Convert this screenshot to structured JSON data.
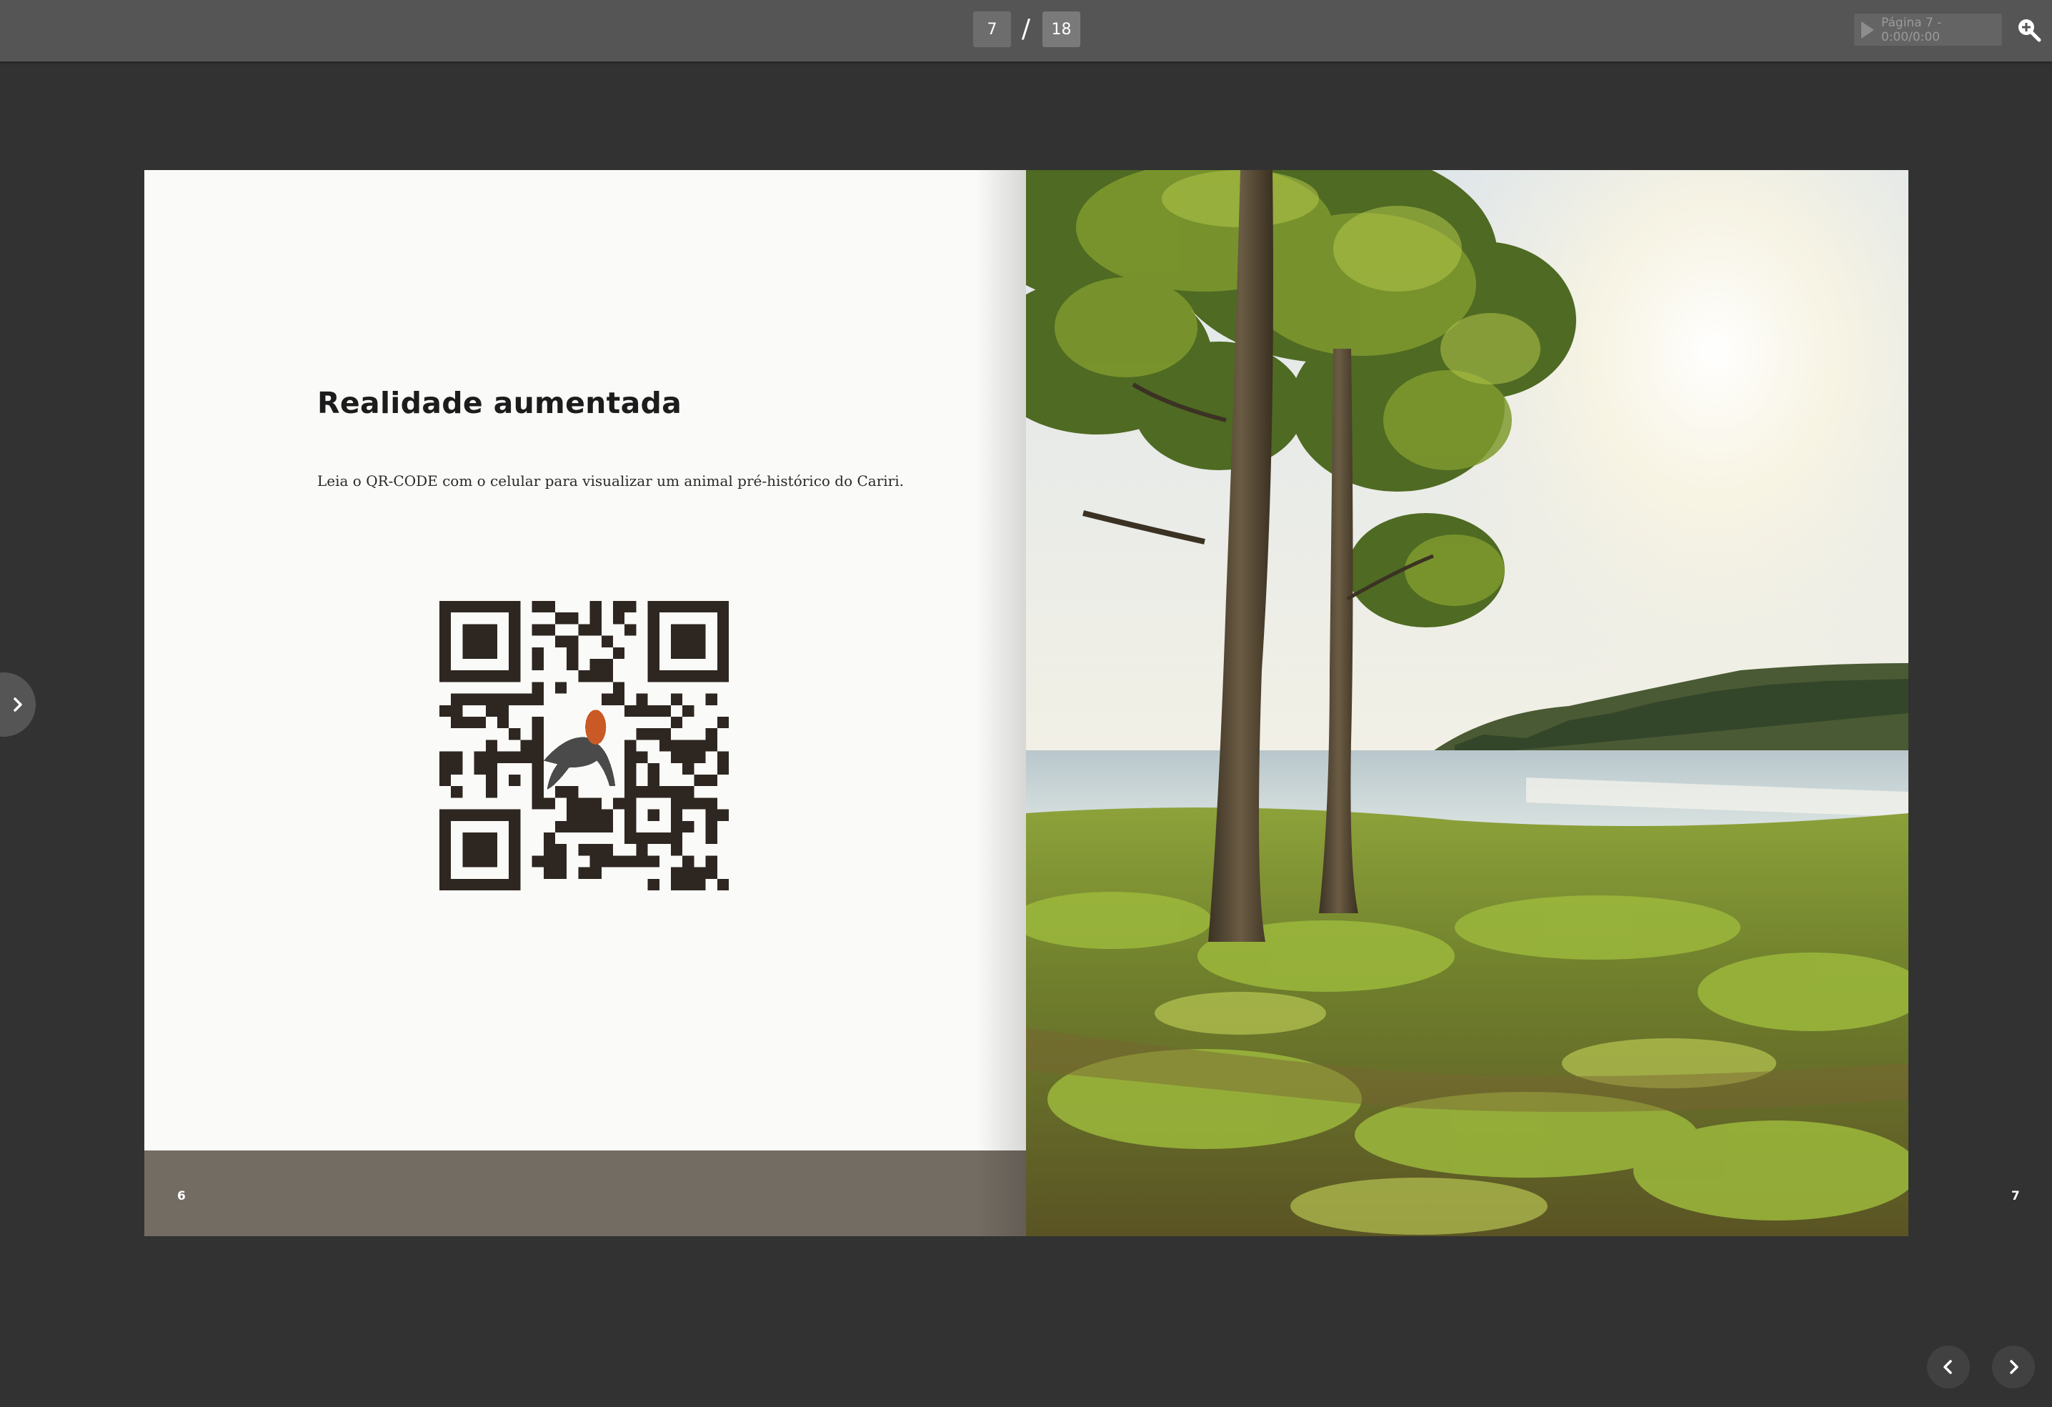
{
  "toolbar": {
    "current_page": "7",
    "separator": "/",
    "total_pages": "18",
    "audio_label": "Página 7 - 0:00/0:00",
    "zoom_icon": "zoom-in-icon"
  },
  "left_page": {
    "heading": "Realidade aumentada",
    "body": "Leia o QR-CODE com o celular para visualizar um animal pré-histórico do Cariri.",
    "page_number": "6",
    "footer_color": "#736c63"
  },
  "right_page": {
    "page_number": "7"
  },
  "controls": {
    "sidebar_icon": "chevron-right-icon",
    "prev_icon": "chevron-left-icon",
    "next_icon": "chevron-right-icon"
  }
}
